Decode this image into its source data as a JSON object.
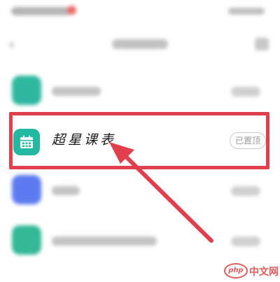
{
  "highlighted_app": {
    "name": "超星课表",
    "status_badge": "已置顶",
    "icon": "calendar-icon",
    "icon_color": "#22b8a1"
  },
  "blurred_app_icons": [
    "#2fb7a0",
    "#5d7bf0",
    "#34b897"
  ],
  "annotation": {
    "box_color": "#e0404e",
    "arrow_color": "#e0404e"
  },
  "watermark": {
    "logo": "php",
    "text": "中文网"
  }
}
